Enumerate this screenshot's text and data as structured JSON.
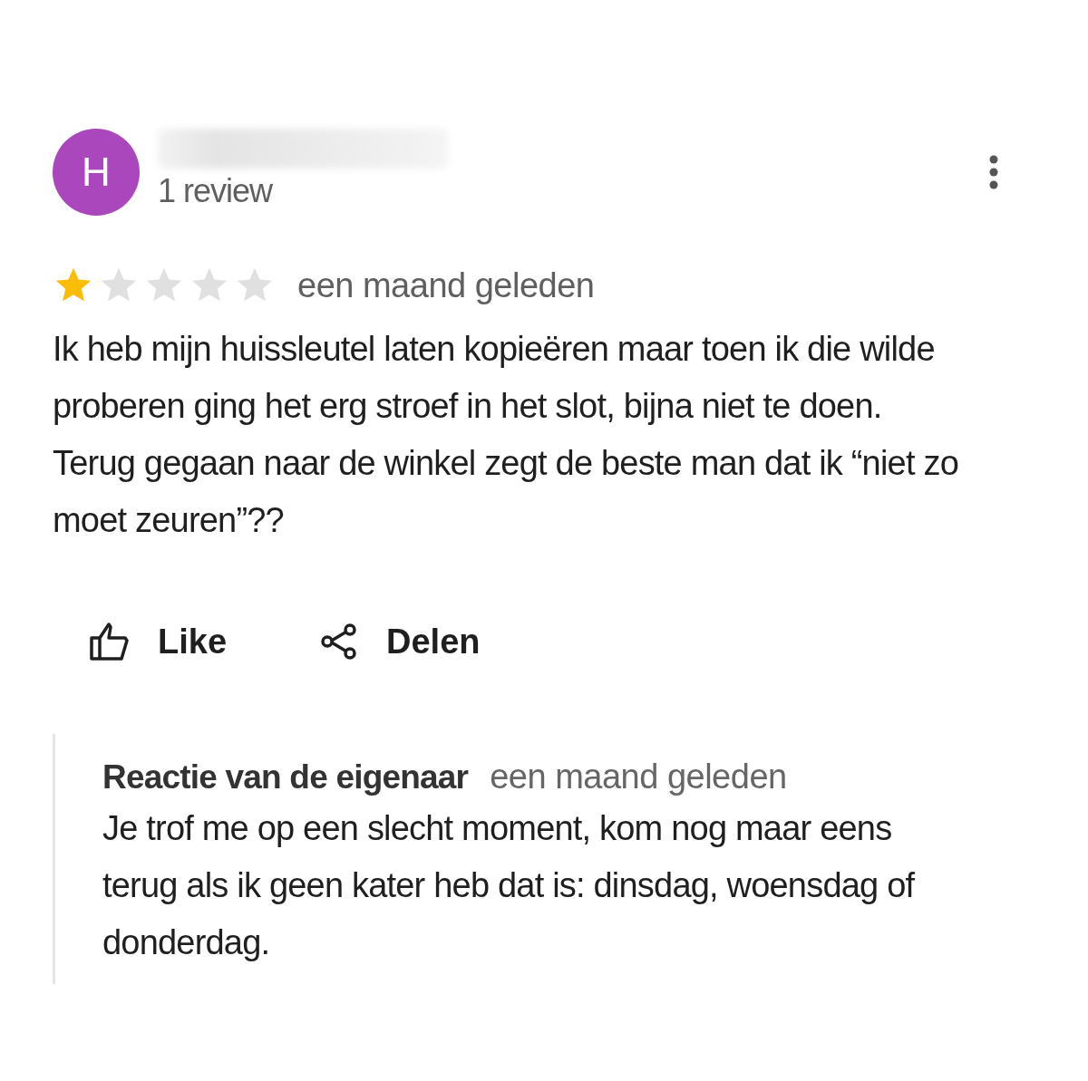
{
  "review": {
    "avatar_letter": "H",
    "review_count": "1 review",
    "stars": 1,
    "time": "een maand geleden",
    "text": "Ik heb mijn huissleutel laten kopieëren maar toen ik die wilde proberen ging het erg stroef in het slot, bijna niet te doen. Terug gegaan naar de winkel zegt de beste man dat ik “niet zo moet zeuren”??"
  },
  "actions": [
    {
      "kind": "like",
      "label": "Like"
    },
    {
      "kind": "share",
      "label": "Delen"
    }
  ],
  "owner_reply": {
    "title": "Reactie van de eigenaar",
    "time": "een maand geleden",
    "text": "Je trof me op een slecht moment, kom nog maar eens terug als ik geen kater heb dat is: dinsdag, woensdag of donderdag."
  }
}
